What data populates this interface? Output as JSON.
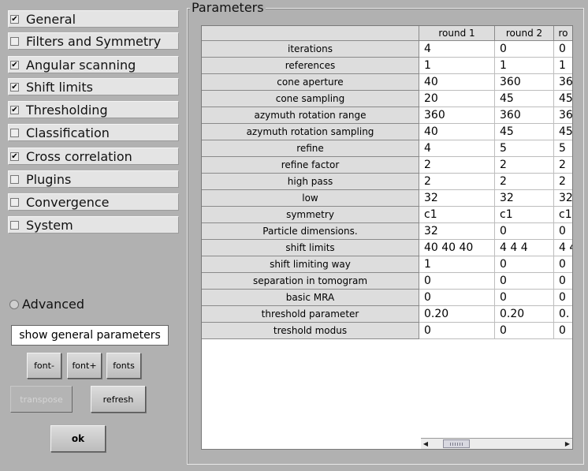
{
  "categories": [
    {
      "label": "General",
      "checked": true
    },
    {
      "label": "Filters and Symmetry",
      "checked": false
    },
    {
      "label": "Angular scanning",
      "checked": true
    },
    {
      "label": "Shift limits",
      "checked": true
    },
    {
      "label": "Thresholding",
      "checked": true
    },
    {
      "label": "Classification",
      "checked": false
    },
    {
      "label": "Cross correlation",
      "checked": true
    },
    {
      "label": "Plugins",
      "checked": false
    },
    {
      "label": "Convergence",
      "checked": false
    },
    {
      "label": "System",
      "checked": false
    }
  ],
  "advanced": {
    "label": "Advanced"
  },
  "buttons": {
    "show_general": "show general parameters",
    "font_minus": "font-",
    "font_plus": "font+",
    "fonts": "fonts",
    "transpose": "transpose",
    "refresh": "refresh",
    "ok": "ok"
  },
  "parameters": {
    "legend": "Parameters",
    "columns": [
      "round 1",
      "round 2",
      "ro"
    ],
    "rows": [
      {
        "name": "iterations",
        "values": [
          "4",
          "0",
          "0"
        ]
      },
      {
        "name": "references",
        "values": [
          "1",
          "1",
          "1"
        ]
      },
      {
        "name": "cone aperture",
        "values": [
          "40",
          "360",
          "36"
        ]
      },
      {
        "name": "cone sampling",
        "values": [
          "20",
          "45",
          "45"
        ]
      },
      {
        "name": "azymuth rotation range",
        "values": [
          "360",
          "360",
          "36"
        ]
      },
      {
        "name": "azymuth rotation sampling",
        "values": [
          "40",
          "45",
          "45"
        ]
      },
      {
        "name": "refine",
        "values": [
          "4",
          "5",
          "5"
        ]
      },
      {
        "name": "refine factor",
        "values": [
          "2",
          "2",
          "2"
        ]
      },
      {
        "name": "high pass",
        "values": [
          "2",
          "2",
          "2"
        ]
      },
      {
        "name": "low",
        "values": [
          "32",
          "32",
          "32"
        ]
      },
      {
        "name": "symmetry",
        "values": [
          "c1",
          "c1",
          "c1"
        ]
      },
      {
        "name": "Particle dimensions.",
        "values": [
          "32",
          "0",
          "0"
        ]
      },
      {
        "name": "shift limits",
        "values": [
          "40 40 40",
          "4 4 4",
          "4 4"
        ]
      },
      {
        "name": "shift limiting way",
        "values": [
          "1",
          "0",
          "0"
        ]
      },
      {
        "name": "separation in tomogram",
        "values": [
          "0",
          "0",
          "0"
        ]
      },
      {
        "name": "basic MRA",
        "values": [
          "0",
          "0",
          "0"
        ]
      },
      {
        "name": "threshold parameter",
        "values": [
          " 0.20",
          " 0.20",
          " 0."
        ]
      },
      {
        "name": "treshold modus",
        "values": [
          "0",
          "0",
          "0"
        ]
      }
    ]
  },
  "scrollbar": {
    "left_arrow": "◀",
    "right_arrow": "▶"
  }
}
